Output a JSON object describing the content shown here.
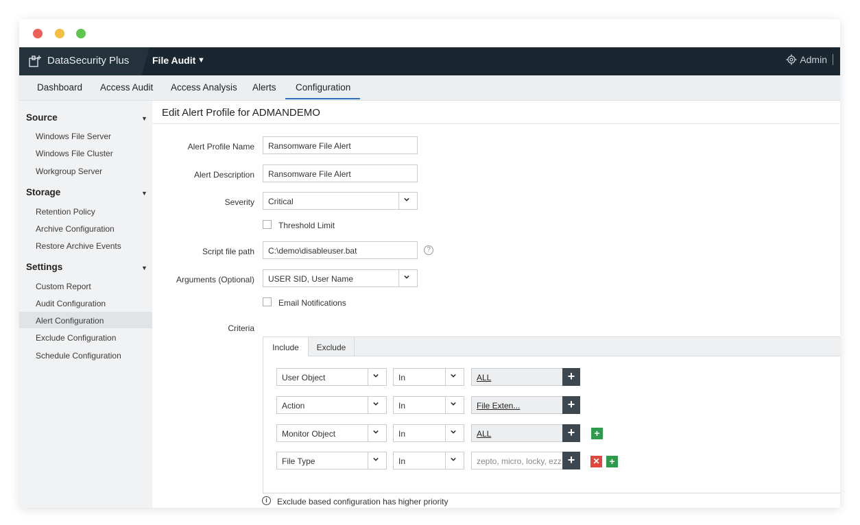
{
  "app": {
    "brand_name": "DataSecurity Plus",
    "module": "File Audit",
    "user": "Admin"
  },
  "nav_tabs": [
    {
      "label": "Dashboard"
    },
    {
      "label": "Access Audit"
    },
    {
      "label": "Access Analysis"
    },
    {
      "label": "Alerts"
    },
    {
      "label": "Configuration",
      "active": true
    }
  ],
  "sidebar": {
    "sections": [
      {
        "title": "Source",
        "items": [
          "Windows File Server",
          "Windows File Cluster",
          "Workgroup Server"
        ]
      },
      {
        "title": "Storage",
        "items": [
          "Retention Policy",
          "Archive Configuration",
          "Restore Archive Events"
        ]
      },
      {
        "title": "Settings",
        "items": [
          "Custom Report",
          "Audit Configuration",
          "Alert Configuration",
          "Exclude Configuration",
          "Schedule Configuration"
        ]
      }
    ],
    "active_item": "Alert Configuration"
  },
  "page": {
    "title": "Edit Alert Profile for ADMANDEMO"
  },
  "form": {
    "alert_profile_name_label": "Alert Profile Name",
    "alert_profile_name_value": "Ransomware File Alert",
    "alert_description_label": "Alert Description",
    "alert_description_value": "Ransomware File Alert",
    "severity_label": "Severity",
    "severity_value": "Critical",
    "threshold_limit_label": "Threshold Limit",
    "script_file_path_label": "Script file path",
    "script_file_path_value": "C:\\demo\\disableuser.bat",
    "arguments_label": "Arguments (Optional)",
    "arguments_value": "USER SID, User Name",
    "email_notifications_label": "Email Notifications",
    "criteria_label": "Criteria"
  },
  "criteria": {
    "tabs": [
      {
        "label": "Include",
        "active": true
      },
      {
        "label": "Exclude"
      }
    ],
    "rows": [
      {
        "field": "User Object",
        "operator": "In",
        "value": "ALL",
        "value_style": "link"
      },
      {
        "field": "Action",
        "operator": "In",
        "value": "File Exten...",
        "value_style": "link"
      },
      {
        "field": "Monitor Object",
        "operator": "In",
        "value": "ALL",
        "value_style": "link"
      },
      {
        "field": "File Type",
        "operator": "In",
        "value": "zepto, micro, locky, ezz,",
        "value_style": "placeholder"
      }
    ]
  },
  "info_note": "Exclude based configuration has higher priority",
  "colors": {
    "topbar": "#1a2731",
    "accent_blue": "#2a72c0",
    "add_green": "#2e9a4b",
    "remove_red": "#e0463e",
    "dark_button": "#3d4750"
  }
}
